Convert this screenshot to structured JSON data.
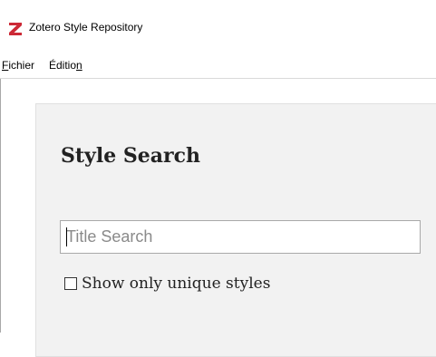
{
  "window": {
    "title": "Zotero Style Repository",
    "app_icon": "zotero-z-logo",
    "brand_color": "#cc2936"
  },
  "menubar": {
    "items": [
      {
        "label_mnemonic": "F",
        "label_rest": "ichier"
      },
      {
        "label_start": "Éditio",
        "label_mnemonic": "n"
      }
    ]
  },
  "panel": {
    "heading": "Style Search",
    "search": {
      "placeholder": "Title Search",
      "value": ""
    },
    "unique_styles_checkbox": {
      "label": "Show only unique styles",
      "checked": false
    }
  }
}
